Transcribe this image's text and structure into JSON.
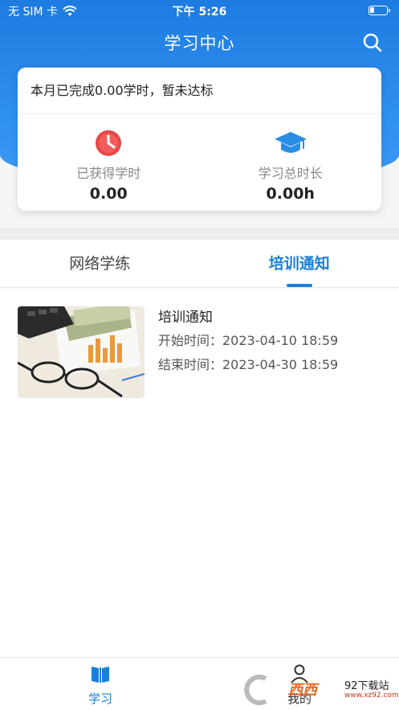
{
  "status_bar": {
    "carrier": "无 SIM 卡",
    "time": "下午 5:26"
  },
  "header": {
    "title": "学习中心",
    "search_icon": "search-icon"
  },
  "summary": {
    "status_text": "本月已完成0.00学时，暂未达标",
    "stats": [
      {
        "icon": "clock-icon",
        "label": "已获得学时",
        "value": "0.00",
        "color": "#e84646"
      },
      {
        "icon": "graduation-cap-icon",
        "label": "学习总时长",
        "value": "0.00h",
        "color": "#2a8de4"
      }
    ]
  },
  "tabs": [
    {
      "label": "网络学练",
      "active": false
    },
    {
      "label": "培训通知",
      "active": true
    }
  ],
  "notices": [
    {
      "title": "培训通知",
      "start": "开始时间：2023-04-10 18:59",
      "end": "结束时间：2023-04-30 18:59"
    }
  ],
  "bottom_nav": [
    {
      "label": "学习",
      "icon": "book-icon",
      "active": true
    },
    {
      "label": "我的",
      "icon": "person-icon",
      "active": false
    }
  ],
  "watermark": {
    "logo_text": "西西",
    "site_name": "92下载站",
    "site_url": "www.xz92.com"
  },
  "colors": {
    "primary": "#1a7fd9",
    "header_gradient_top": "#1e7be0",
    "clock_red": "#e84646",
    "cap_blue": "#2a8de4"
  }
}
